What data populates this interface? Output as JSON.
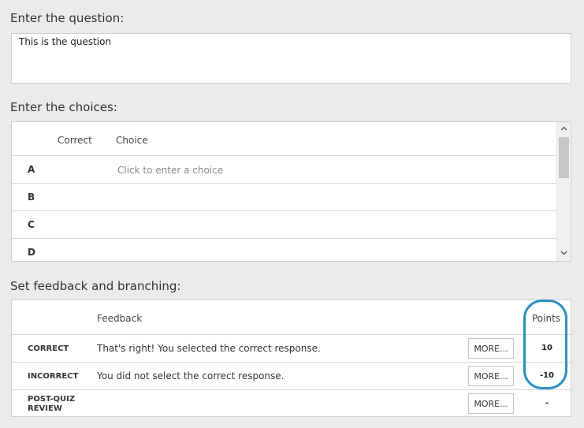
{
  "question": {
    "label": "Enter the question:",
    "text": "This is the question"
  },
  "choices": {
    "label": "Enter the choices:",
    "header_correct": "Correct",
    "header_choice": "Choice",
    "placeholder": "Click to enter a choice",
    "rows": [
      {
        "letter": "A"
      },
      {
        "letter": "B"
      },
      {
        "letter": "C"
      },
      {
        "letter": "D"
      }
    ],
    "scroll_up_icon": "chevron-up-icon",
    "scroll_down_icon": "chevron-down-icon"
  },
  "feedback": {
    "label": "Set feedback and branching:",
    "header_feedback": "Feedback",
    "header_points": "Points",
    "more_label": "MORE...",
    "highlight_color": "#2e8fc0",
    "rows": [
      {
        "label": "CORRECT",
        "text": "That's right! You selected the correct response.",
        "points": "10"
      },
      {
        "label": "INCORRECT",
        "text": "You did not select the correct response.",
        "points": "-10"
      },
      {
        "label_line1": "POST-QUIZ",
        "label_line2": "REVIEW",
        "text": "",
        "points": "-"
      }
    ]
  }
}
